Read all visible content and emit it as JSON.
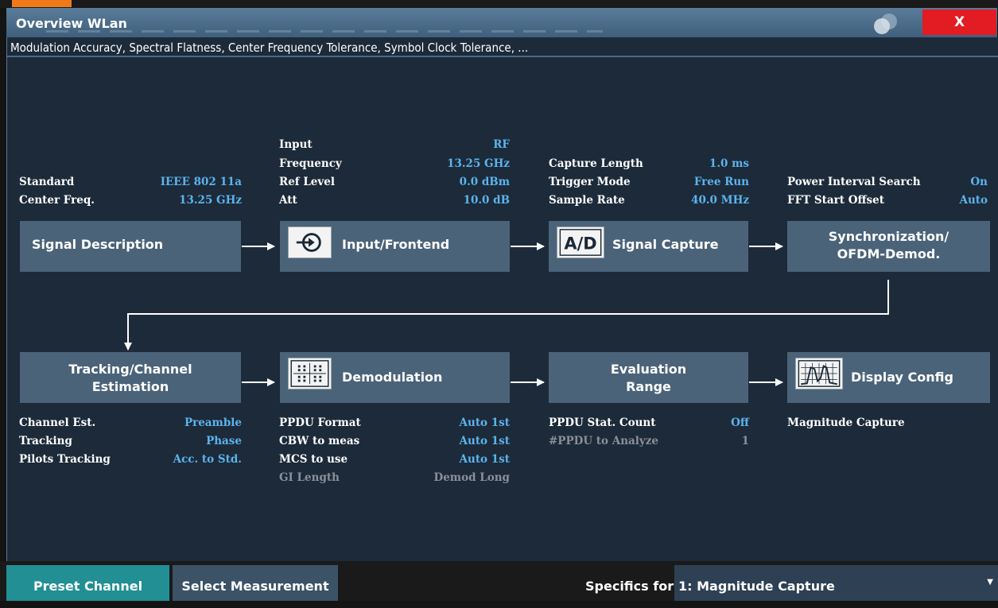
{
  "window": {
    "title": "Overview WLan",
    "subtitle": "Modulation Accuracy, Spectral Flatness, Center Frequency Tolerance, Symbol Clock Tolerance, ...",
    "close_label": "X"
  },
  "blocks": {
    "signal_description": {
      "label": "Signal Description",
      "params": [
        {
          "name": "Standard",
          "value": "IEEE 802 11a"
        },
        {
          "name": "Center Freq.",
          "value": "13.25 GHz"
        }
      ]
    },
    "input_frontend": {
      "label": "Input/Frontend",
      "icon": "input-arrow-icon",
      "params": [
        {
          "name": "Input",
          "value": "RF"
        },
        {
          "name": "Frequency",
          "value": "13.25 GHz"
        },
        {
          "name": "Ref Level",
          "value": "0.0 dBm"
        },
        {
          "name": "Att",
          "value": "10.0 dB"
        }
      ]
    },
    "signal_capture": {
      "label": "Signal Capture",
      "icon": "ad-converter-icon",
      "icon_text": "A/D",
      "params": [
        {
          "name": "Capture Length",
          "value": "1.0 ms"
        },
        {
          "name": "Trigger Mode",
          "value": "Free Run"
        },
        {
          "name": "Sample Rate",
          "value": "40.0 MHz"
        }
      ]
    },
    "synchronization": {
      "label_line1": "Synchronization/",
      "label_line2": "OFDM-Demod.",
      "params": [
        {
          "name": "Power Interval Search",
          "value": "On"
        },
        {
          "name": "FFT Start Offset",
          "value": "Auto"
        }
      ]
    },
    "tracking": {
      "label_line1": "Tracking/Channel",
      "label_line2": "Estimation",
      "params": [
        {
          "name": "Channel Est.",
          "value": "Preamble"
        },
        {
          "name": "Tracking",
          "value": "Phase"
        },
        {
          "name": "Pilots Tracking",
          "value": "Acc. to Std."
        }
      ]
    },
    "demodulation": {
      "label": "Demodulation",
      "icon": "constellation-icon",
      "params": [
        {
          "name": "PPDU Format",
          "value": "Auto 1st"
        },
        {
          "name": "CBW to meas",
          "value": "Auto 1st"
        },
        {
          "name": "MCS to use",
          "value": "Auto 1st"
        },
        {
          "name": "GI Length",
          "value": "Demod Long",
          "disabled": true
        }
      ]
    },
    "evaluation": {
      "label_line1": "Evaluation",
      "label_line2": "Range",
      "params": [
        {
          "name": "PPDU Stat. Count",
          "value": "Off"
        },
        {
          "name": "#PPDU to Analyze",
          "value": "1",
          "disabled": true
        }
      ]
    },
    "display_config": {
      "label": "Display Config",
      "icon": "spectrum-display-icon",
      "params": [
        {
          "name": "Magnitude Capture",
          "value": ""
        }
      ]
    }
  },
  "bottom_bar": {
    "preset_label": "Preset Channel",
    "select_label": "Select Measurement",
    "specifics_label": "Specifics for",
    "specifics_value": "1: Magnitude Capture"
  },
  "colors": {
    "title_bar": "#4a6b8a",
    "block": "#4b6379",
    "value_text": "#5cb4ec",
    "close_button": "#e31b23",
    "preset_button": "#218f94",
    "accent_tab": "#f07a1a"
  }
}
